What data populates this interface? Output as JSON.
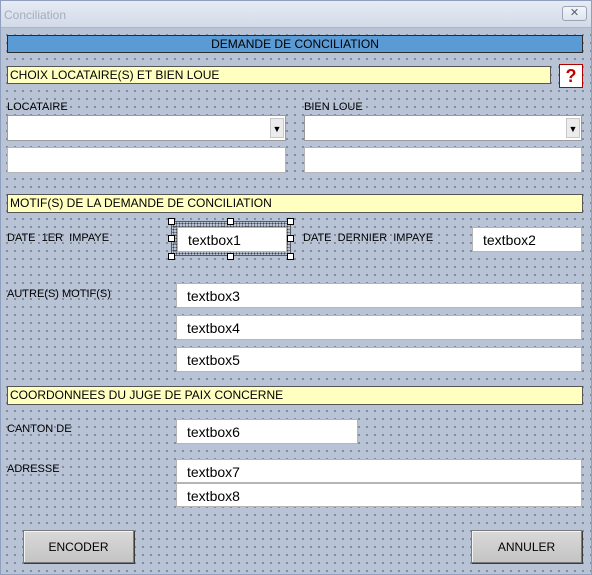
{
  "window": {
    "title": "Conciliation",
    "close_glyph": "✕"
  },
  "banner": "DEMANDE DE CONCILIATION",
  "section_choix": {
    "title": "CHOIX  LOCATAIRE(S) ET BIEN LOUE",
    "help_glyph": "?"
  },
  "locataire": {
    "label": "LOCATAIRE",
    "combo_value": "",
    "text_value": ""
  },
  "bien": {
    "label": "BIEN LOUE",
    "combo_value": "",
    "text_value": ""
  },
  "section_motif": {
    "title": "MOTIF(S) DE LA DEMANDE DE CONCILIATION"
  },
  "date_premier": {
    "label": "DATE  1ER  IMPAYE",
    "value": "textbox1"
  },
  "date_dernier": {
    "label": "DATE  DERNIER  IMPAYE",
    "value": "textbox2"
  },
  "autres": {
    "label": "AUTRE(S) MOTIF(S)",
    "values": [
      "textbox3",
      "textbox4",
      "textbox5"
    ]
  },
  "section_juge": {
    "title": "COORDONNEES DU JUGE DE PAIX CONCERNE"
  },
  "canton": {
    "label": "CANTON DE",
    "value": "textbox6"
  },
  "adresse": {
    "label": "ADRESSE",
    "values": [
      "textbox7",
      "textbox8"
    ]
  },
  "buttons": {
    "encoder": "ENCODER",
    "annuler": "ANNULER"
  },
  "icons": {
    "dropdown": "chevron-down-icon",
    "help": "help-icon",
    "close": "close-icon"
  },
  "colors": {
    "banner_blue": "#5b9bd5",
    "section_yellow": "#ffffc0",
    "form_bg": "#b9c3d6",
    "help_red": "#c00000"
  }
}
